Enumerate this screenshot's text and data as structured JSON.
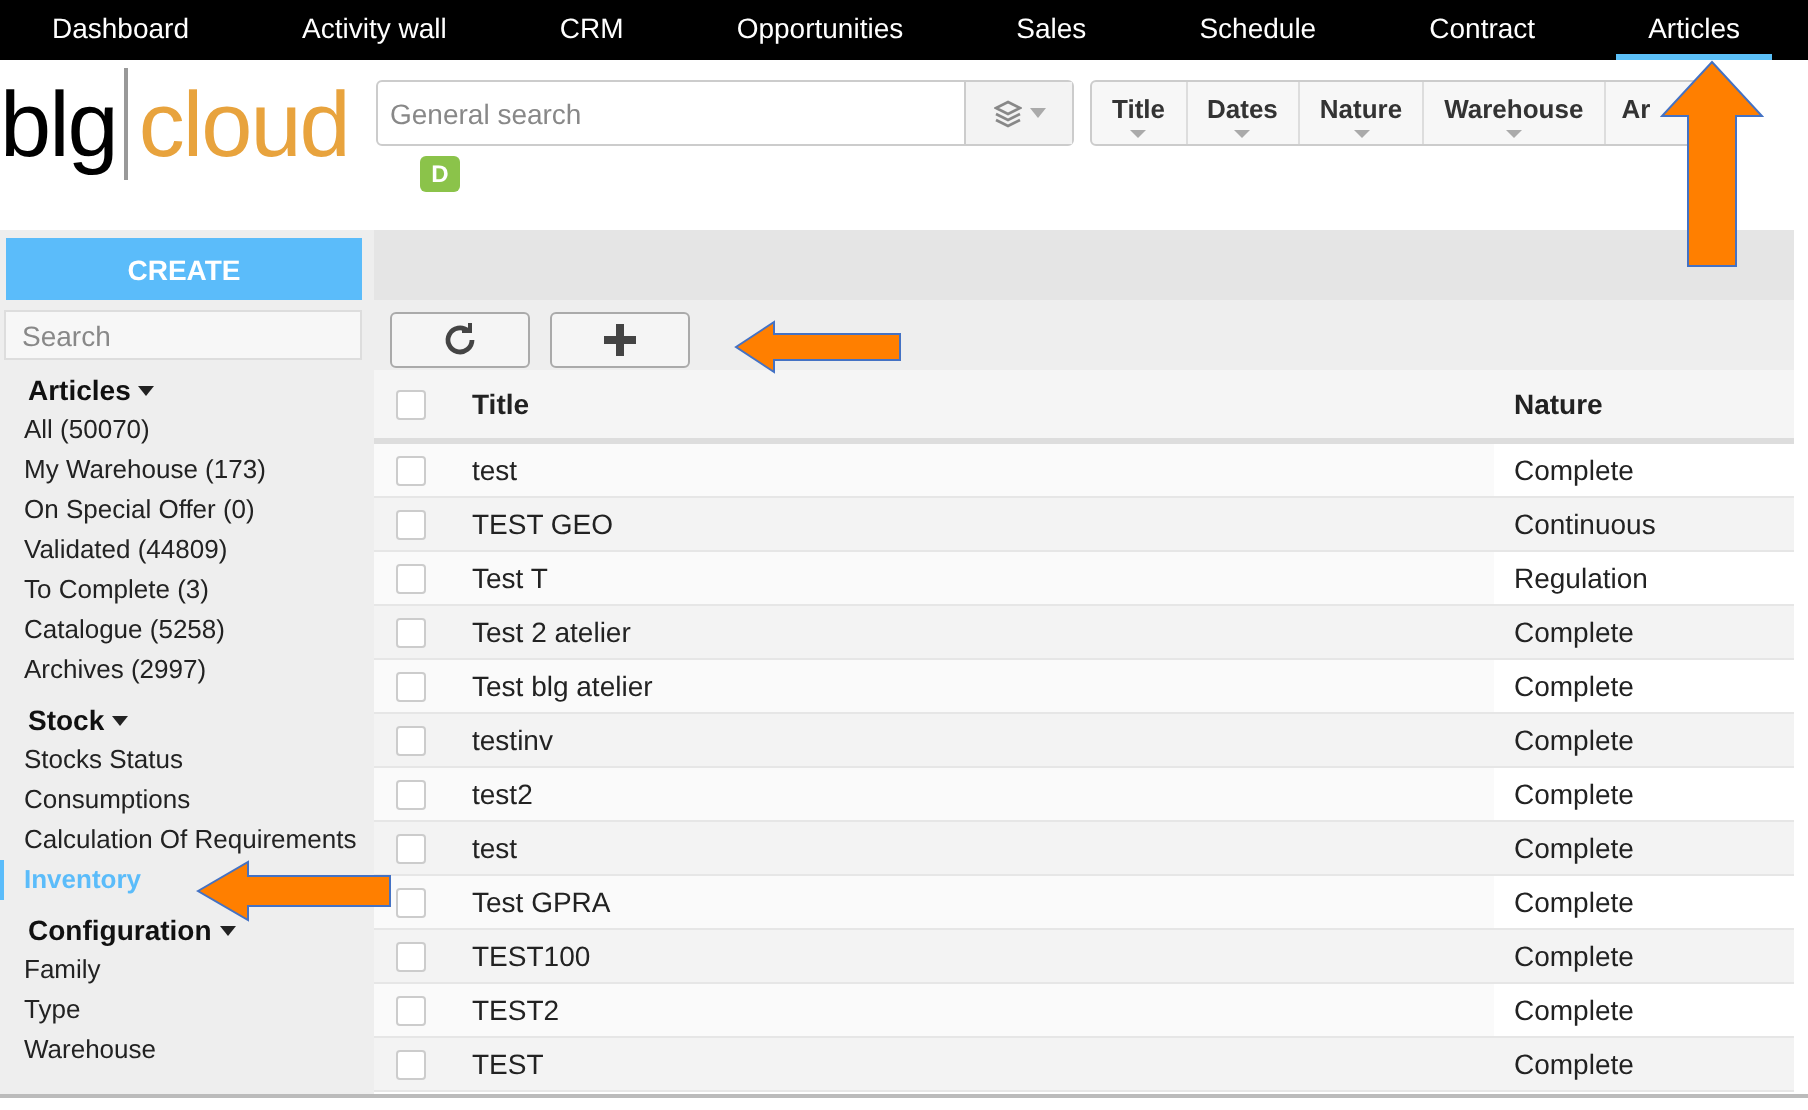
{
  "nav": [
    {
      "label": "Dashboard",
      "selected": false
    },
    {
      "label": "Activity wall",
      "selected": false
    },
    {
      "label": "CRM",
      "selected": false
    },
    {
      "label": "Opportunities",
      "selected": false
    },
    {
      "label": "Sales",
      "selected": false
    },
    {
      "label": "Schedule",
      "selected": false
    },
    {
      "label": "Contract",
      "selected": false
    },
    {
      "label": "Articles",
      "selected": true
    }
  ],
  "logo": {
    "left": "blg",
    "right": "cloud"
  },
  "search": {
    "placeholder": "General search",
    "badge": "D"
  },
  "filters": [
    "Title",
    "Dates",
    "Nature",
    "Warehouse",
    "Ar"
  ],
  "sidebar": {
    "create": "CREATE",
    "search_placeholder": "Search",
    "sections": [
      {
        "title": "Articles",
        "items": [
          {
            "label": "All (50070)",
            "selected": false
          },
          {
            "label": "My Warehouse (173)",
            "selected": false
          },
          {
            "label": "On Special Offer (0)",
            "selected": false
          },
          {
            "label": "Validated (44809)",
            "selected": false
          },
          {
            "label": "To Complete (3)",
            "selected": false
          },
          {
            "label": "Catalogue (5258)",
            "selected": false
          },
          {
            "label": "Archives (2997)",
            "selected": false
          }
        ]
      },
      {
        "title": "Stock",
        "items": [
          {
            "label": "Stocks Status",
            "selected": false
          },
          {
            "label": "Consumptions",
            "selected": false
          },
          {
            "label": "Calculation Of Requirements",
            "selected": false
          },
          {
            "label": "Inventory",
            "selected": true
          }
        ]
      },
      {
        "title": "Configuration",
        "items": [
          {
            "label": "Family",
            "selected": false
          },
          {
            "label": "Type",
            "selected": false
          },
          {
            "label": "Warehouse",
            "selected": false
          }
        ]
      }
    ]
  },
  "table": {
    "columns": [
      "Title",
      "Nature"
    ],
    "all_checked": false,
    "rows": [
      {
        "title": "test",
        "nature": "Complete",
        "checked": false
      },
      {
        "title": "TEST GEO",
        "nature": "Continuous",
        "checked": false
      },
      {
        "title": "Test T",
        "nature": "Regulation",
        "checked": false
      },
      {
        "title": "Test 2 atelier",
        "nature": "Complete",
        "checked": false
      },
      {
        "title": "Test blg atelier",
        "nature": "Complete",
        "checked": false
      },
      {
        "title": "testinv",
        "nature": "Complete",
        "checked": false
      },
      {
        "title": "test2",
        "nature": "Complete",
        "checked": false
      },
      {
        "title": "test",
        "nature": "Complete",
        "checked": false
      },
      {
        "title": "Test GPRA",
        "nature": "Complete",
        "checked": false
      },
      {
        "title": "TEST100",
        "nature": "Complete",
        "checked": false
      },
      {
        "title": "TEST2",
        "nature": "Complete",
        "checked": false
      },
      {
        "title": "TEST",
        "nature": "Complete",
        "checked": false
      }
    ]
  }
}
